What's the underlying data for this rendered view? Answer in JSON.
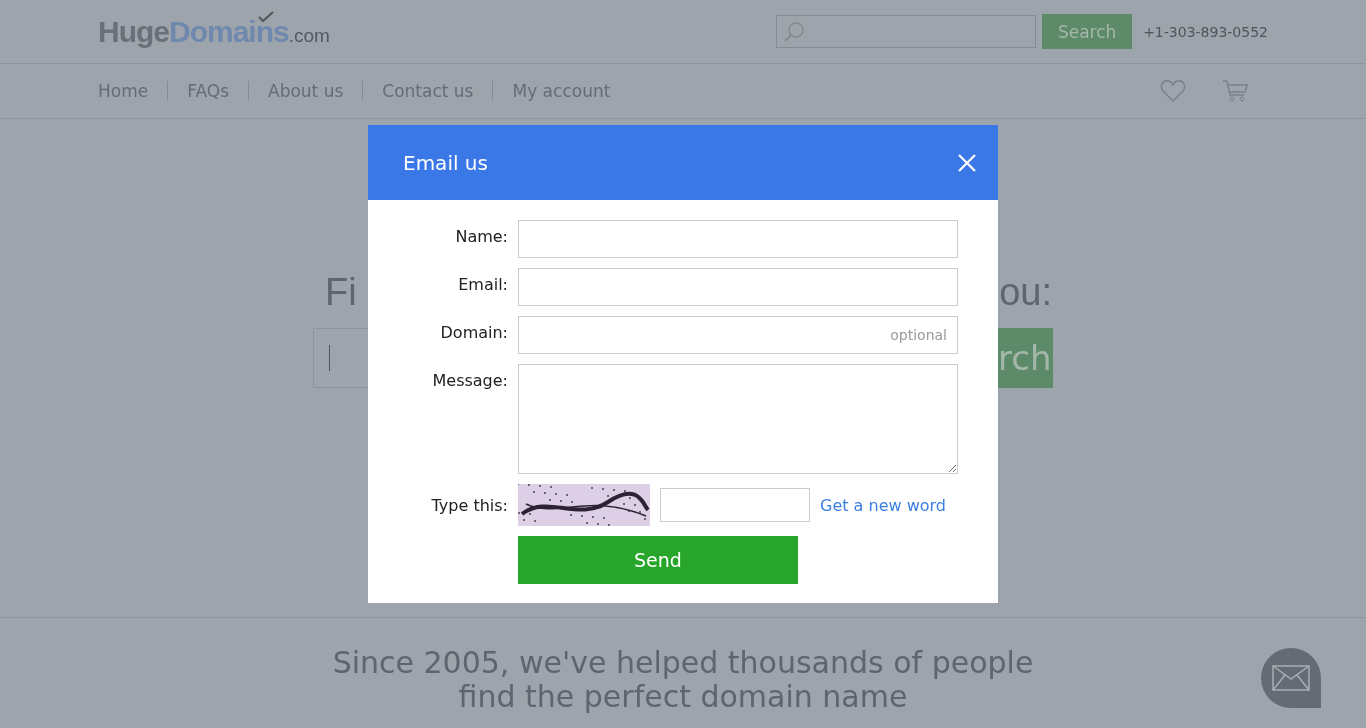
{
  "header": {
    "logo": {
      "parts": [
        "Huge",
        "Domains",
        ".com"
      ]
    },
    "search": {
      "button": "Search"
    },
    "phone": "+1-303-893-0552"
  },
  "nav": {
    "items": [
      {
        "label": "Home"
      },
      {
        "label": "FAQs"
      },
      {
        "label": "About us"
      },
      {
        "label": "Contact us"
      },
      {
        "label": "My account"
      }
    ]
  },
  "hero": {
    "heading_left": "Fi",
    "heading_right": "ou:",
    "search_button": "rch"
  },
  "bottom": {
    "lines": [
      "Since 2005, we've helped thousands of people",
      "find the perfect domain name"
    ]
  },
  "dialog": {
    "title": "Email us",
    "fields": [
      {
        "label": "Name:",
        "kind": "input"
      },
      {
        "label": "Email:",
        "kind": "input"
      },
      {
        "label": "Domain:",
        "kind": "input",
        "placeholder": "optional"
      },
      {
        "label": "Message:",
        "kind": "textarea"
      }
    ],
    "captcha": {
      "label": "Type this:",
      "link": "Get a new word"
    },
    "send": "Send"
  }
}
